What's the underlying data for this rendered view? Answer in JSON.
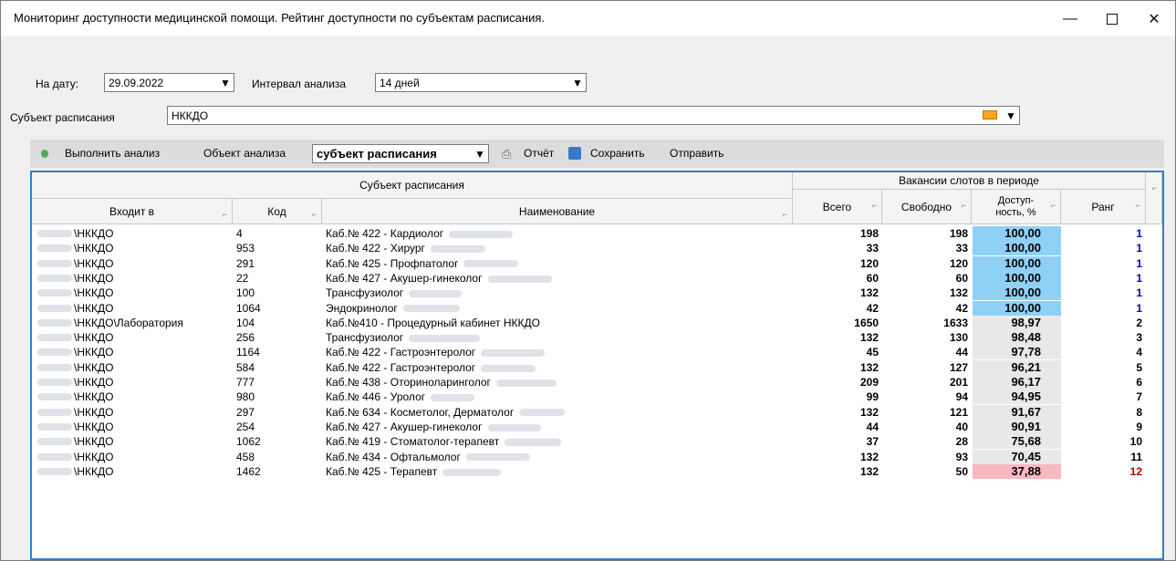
{
  "window": {
    "title": "Мониторинг доступности медицинской помощи. Рейтинг доступности по субъектам расписания."
  },
  "filters": {
    "date_label": "На дату:",
    "date_value": "29.09.2022",
    "interval_label": "Интервал анализа",
    "interval_value": "14 дней",
    "subject_label": "Субъект расписания",
    "subject_value": "НККДО"
  },
  "toolbar": {
    "run_label": "Выполнить анализ",
    "object_label": "Объект анализа",
    "object_value": "субъект расписания",
    "report_label": "Отчёт",
    "save_label": "Сохранить",
    "send_label": "Отправить"
  },
  "grid": {
    "group_subject": "Субъект расписания",
    "group_vacancies": "Вакансии слотов в периоде",
    "columns": {
      "parent": "Входит в",
      "code": "Код",
      "name": "Наименование",
      "total": "Всего",
      "free": "Свободно",
      "access": "Доступ-ность, %",
      "rank": "Ранг"
    },
    "colors": {
      "highlight_blue": "#8fd0f7",
      "access_default": "#e8e8e8",
      "highlight_red": "#f9b8bf",
      "rank_blue": "#0000cc",
      "rank_red": "#b00000"
    },
    "rows": [
      {
        "parent": "\\НККДО",
        "code": "4",
        "name": "Каб.№ 422 - Кардиолог",
        "total": "198",
        "free": "198",
        "access": "100,00",
        "rank": "1"
      },
      {
        "parent": "\\НККДО",
        "code": "953",
        "name": "Каб.№ 422 - Хирург",
        "total": "33",
        "free": "33",
        "access": "100,00",
        "rank": "1"
      },
      {
        "parent": "\\НККДО",
        "code": "291",
        "name": "Каб.№ 425 - Профпатолог",
        "total": "120",
        "free": "120",
        "access": "100,00",
        "rank": "1"
      },
      {
        "parent": "\\НККДО",
        "code": "22",
        "name": "Каб.№ 427 - Акушер-гинеколог",
        "total": "60",
        "free": "60",
        "access": "100,00",
        "rank": "1"
      },
      {
        "parent": "\\НККДО",
        "code": "100",
        "name": "Трансфузиолог",
        "total": "132",
        "free": "132",
        "access": "100,00",
        "rank": "1"
      },
      {
        "parent": "\\НККДО",
        "code": "1064",
        "name": "Эндокринолог",
        "total": "42",
        "free": "42",
        "access": "100,00",
        "rank": "1"
      },
      {
        "parent": "\\НККДО\\Лаборатория",
        "code": "104",
        "name": "Каб.№410 - Процедурный кабинет НККДО",
        "total": "1650",
        "free": "1633",
        "access": "98,97",
        "rank": "2"
      },
      {
        "parent": "\\НККДО",
        "code": "256",
        "name": "Трансфузиолог",
        "total": "132",
        "free": "130",
        "access": "98,48",
        "rank": "3"
      },
      {
        "parent": "\\НККДО",
        "code": "1164",
        "name": "Каб.№ 422 - Гастроэнтеролог",
        "total": "45",
        "free": "44",
        "access": "97,78",
        "rank": "4"
      },
      {
        "parent": "\\НККДО",
        "code": "584",
        "name": "Каб.№ 422 - Гастроэнтеролог",
        "total": "132",
        "free": "127",
        "access": "96,21",
        "rank": "5"
      },
      {
        "parent": "\\НККДО",
        "code": "777",
        "name": "Каб.№ 438 - Оториноларинголог",
        "total": "209",
        "free": "201",
        "access": "96,17",
        "rank": "6"
      },
      {
        "parent": "\\НККДО",
        "code": "980",
        "name": "Каб.№ 446 - Уролог",
        "total": "99",
        "free": "94",
        "access": "94,95",
        "rank": "7"
      },
      {
        "parent": "\\НККДО",
        "code": "297",
        "name": "Каб.№ 634 - Косметолог, Дерматолог",
        "total": "132",
        "free": "121",
        "access": "91,67",
        "rank": "8"
      },
      {
        "parent": "\\НККДО",
        "code": "254",
        "name": "Каб.№ 427 - Акушер-гинеколог",
        "total": "44",
        "free": "40",
        "access": "90,91",
        "rank": "9"
      },
      {
        "parent": "\\НККДО",
        "code": "1062",
        "name": "Каб.№ 419 - Стоматолог-терапевт",
        "total": "37",
        "free": "28",
        "access": "75,68",
        "rank": "10"
      },
      {
        "parent": "\\НККДО",
        "code": "458",
        "name": "Каб.№ 434 - Офтальмолог",
        "total": "132",
        "free": "93",
        "access": "70,45",
        "rank": "11"
      },
      {
        "parent": "\\НККДО",
        "code": "1462",
        "name": "Каб.№ 425 - Терапевт",
        "total": "132",
        "free": "50",
        "access": "37,88",
        "rank": "12"
      }
    ]
  }
}
